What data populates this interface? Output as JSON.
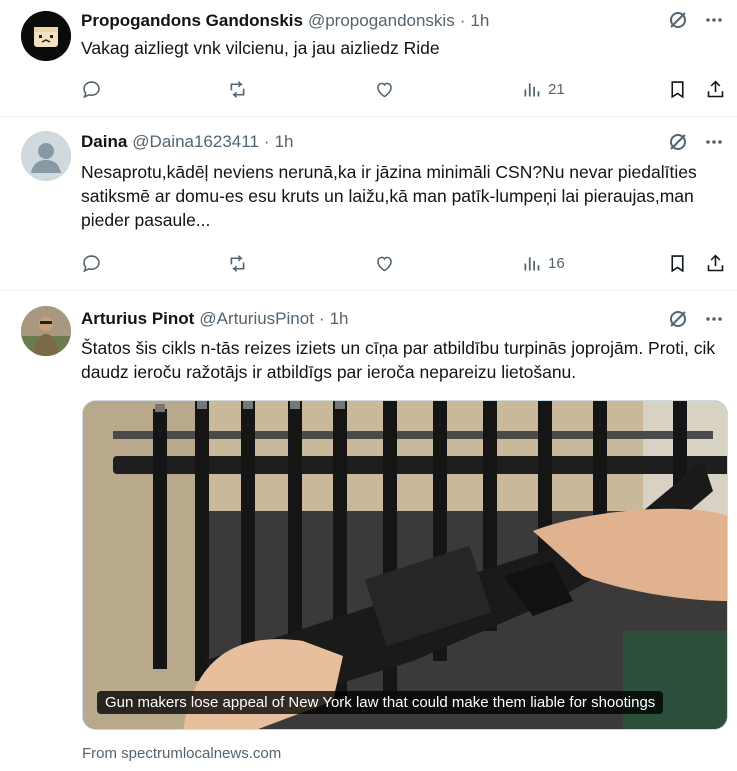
{
  "tweets": [
    {
      "name": "Propogandons Gandonskis",
      "handle": "@propogandonskis",
      "dot": "·",
      "time": "1h",
      "text": "Vakag aizliegt vnk vilcienu, ja jau aizliedz Ride",
      "views": "21",
      "avatar_icon": "toast-face-icon"
    },
    {
      "name": "Daina",
      "handle": "@Daina1623411",
      "dot": "·",
      "time": "1h",
      "text": "Nesaprotu,kādēļ neviens nerunā,ka ir jāzina minimāli CSN?Nu nevar piedalīties satiksmē ar domu-es esu kruts un laižu,kā man patīk-lumpeņi lai pieraujas,man pieder pasaule...",
      "views": "16",
      "avatar_icon": "default-user-icon"
    },
    {
      "name": "Arturius Pinot",
      "handle": "@ArturiusPinot",
      "dot": "·",
      "time": "1h",
      "text": "Štatos šis cikls n-tās reizes iziets un cīņa par atbildību turpinās joprojām. Proti, cik daudz ieroču ražotājs ir atbildīgs par ieroča nepareizu lietošanu.",
      "media_caption": "Gun makers lose appeal of New York law that could make them liable for shootings",
      "source": "From spectrumlocalnews.com",
      "avatar_icon": "person-photo-icon"
    }
  ],
  "icons": {
    "reply": "reply-icon",
    "repost": "repost-icon",
    "like": "like-icon",
    "views": "views-icon",
    "bookmark": "bookmark-icon",
    "share": "share-icon",
    "grok": "grok-icon",
    "more": "more-icon"
  },
  "colors": {
    "text": "#0f1419",
    "secondary": "#536471",
    "divider": "#eff3f4"
  }
}
